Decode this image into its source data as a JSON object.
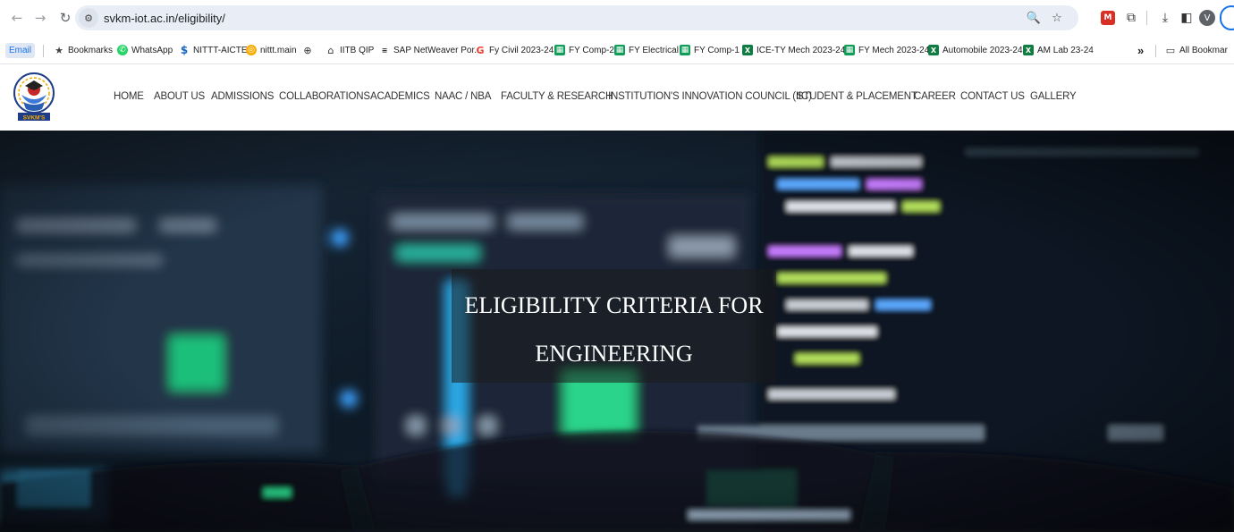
{
  "browser": {
    "url": "svkm-iot.ac.in/eligibility/",
    "profile_initial": "V",
    "ext_label": "M"
  },
  "bookmarks": {
    "email": "Email",
    "items": [
      {
        "label": "Bookmarks",
        "icon": "star-icon"
      },
      {
        "label": "WhatsApp",
        "icon": "whatsapp-icon"
      },
      {
        "label": "NITTT-AICTE",
        "icon": "dollar-icon"
      },
      {
        "label": "nittt.main",
        "icon": "swirl-icon"
      },
      {
        "label": "",
        "icon": "globe-icon"
      },
      {
        "label": "IITB QIP",
        "icon": "building-icon"
      },
      {
        "label": "SAP NetWeaver Por...",
        "icon": "sap-icon"
      },
      {
        "label": "Fy Civil 2023-24",
        "icon": "google-icon"
      },
      {
        "label": "FY Comp-2",
        "icon": "sheets-icon"
      },
      {
        "label": "FY Electrical",
        "icon": "sheets-icon"
      },
      {
        "label": "FY Comp-1",
        "icon": "sheets-icon"
      },
      {
        "label": "ICE-TY Mech 2023-24",
        "icon": "excel-icon"
      },
      {
        "label": "FY Mech 2023-24",
        "icon": "sheets-icon"
      },
      {
        "label": "Automobile 2023-24",
        "icon": "excel-icon"
      },
      {
        "label": "AM Lab 23-24",
        "icon": "excel-icon"
      }
    ],
    "overflow": "»",
    "all_bookmarks": "All Bookmar"
  },
  "site": {
    "logo_text": "SVKM'S",
    "menu": [
      "HOME",
      "ABOUT US",
      "ADMISSIONS",
      "COLLABORATIONS",
      "ACADEMICS",
      "NAAC / NBA",
      "FACULTY & RESEARCH",
      "INSTITUTION'S INNOVATION COUNCIL (IIC)",
      "STUDENT & PLACEMENT",
      "CAREER",
      "CONTACT US",
      "GALLERY"
    ]
  },
  "hero": {
    "title_line1": "ELIGIBILITY CRITERIA FOR",
    "title_line2": "ENGINEERING"
  },
  "colors": {
    "accent": "#1a73e8",
    "omnibox_bg": "#e9eef6",
    "hero_bg": "#0c1622"
  }
}
